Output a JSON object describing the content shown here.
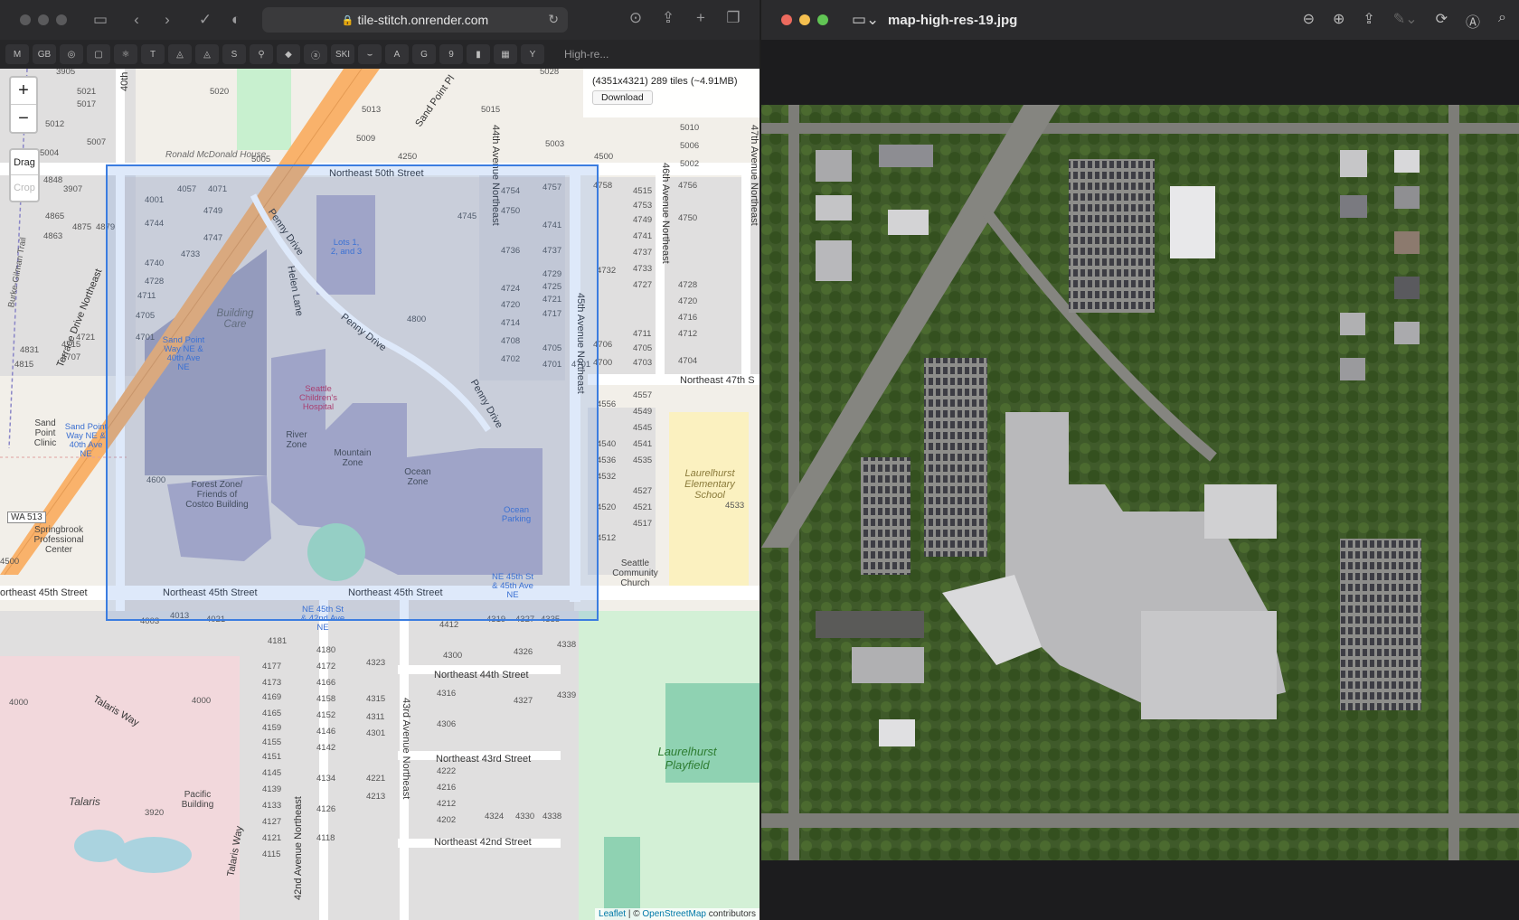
{
  "safari": {
    "url": "tile-stitch.onrender.com",
    "favorites": [
      "M",
      "GB",
      "◎",
      "▢",
      "⚛",
      "T",
      "◬",
      "◬",
      "S",
      "⚲",
      "◆",
      "ⓐ",
      "SKI",
      "⌣",
      "A",
      "G",
      "9",
      "▮",
      "▦",
      "Y"
    ],
    "tab_label": "High-re..."
  },
  "map": {
    "zoom_in": "+",
    "zoom_out": "−",
    "drag_label": "Drag",
    "crop_label": "Crop",
    "info_text": "(4351x4321) 289 tiles (~4.91MB)",
    "download_label": "Download",
    "attribution_leaflet": "Leaflet",
    "attribution_sep": " | © ",
    "attribution_osm": "OpenStreetMap",
    "attribution_tail": " contributors",
    "streets": {
      "ne50": "Northeast 50th Street",
      "ne47": "Northeast 47th S",
      "ne45_a": "Northeast 45th Street",
      "ne45_b": "Northeast 45th Street",
      "ne45_left": "ortheast 45th Street",
      "ne44": "Northeast 44th Street",
      "ne43": "Northeast 43rd Street",
      "ne42": "Northeast 42nd Street",
      "ave45": "45th Avenue Northeast",
      "ave46": "46th Avenue Northeast",
      "ave47": "47th Avenue Northeast",
      "ave44": "44th Avenue Northeast",
      "ave43": "43rd Avenue Northeast",
      "ave42": "42nd Avenue Northeast",
      "ave40": "40th",
      "penny1": "Penny Drive",
      "penny2": "Penny Drive",
      "penny3": "Penny Drive",
      "helen": "Helen Lane",
      "sandpoint": "Sand Point Pl",
      "terrace": "Terrace Drive Northeast",
      "burke": "Burke-Gilman Trail",
      "talaris_way": "Talaris Way",
      "talaris_way2": "Talaris Way",
      "wa513": "WA 513"
    },
    "places": {
      "ronald": "Ronald McDonald House",
      "building_care": "Building Care",
      "hospital": "Seattle Children's Hospital",
      "river": "River Zone",
      "mountain": "Mountain Zone",
      "ocean": "Ocean Zone",
      "forest": "Forest Zone/ Friends of Costco Building",
      "ocean_parking": "Ocean Parking",
      "lots": "Lots 1, 2, and 3",
      "sand_clinic": "Sand Point Clinic",
      "springbrook": "Springbrook Professional Center",
      "laurelhurst_school": "Laurelhurst Elementary School",
      "church": "Seattle Community Church",
      "playfield": "Laurelhurst Playfield",
      "talaris": "Talaris",
      "pacific": "Pacific Building",
      "stop1": "Sand Point Way NE & 40th Ave NE",
      "stop2": "Sand Point Way NE & 40th Ave NE",
      "stop3": "NE 45th St & 45th Ave NE",
      "stop4": "NE 45th St & 42nd Ave NE"
    },
    "house_numbers": {
      "n3905": "3905",
      "n5028": "5028",
      "n5020": "5020",
      "n5021": "5021",
      "n5017": "5017",
      "n5013": "5013",
      "n5012": "5012",
      "n5015": "5015",
      "n5007": "5007",
      "n5004": "5004",
      "n5009": "5009",
      "n5005": "5005",
      "n4250": "4250",
      "n4500": "4500",
      "n5003": "5003",
      "n5002": "5002",
      "n5006": "5006",
      "n5010": "5010",
      "n4848": "4848",
      "n3907": "3907",
      "n4001": "4001",
      "n4057": "4057",
      "n4071": "4071",
      "n4865": "4865",
      "n4875": "4875",
      "n4879": "4879",
      "n4749": "4749",
      "n4744": "4744",
      "n4747": "4747",
      "n4863": "4863",
      "n4733": "4733",
      "n4740": "4740",
      "n4728": "4728",
      "n4711": "4711",
      "n4705": "4705",
      "n4701": "4701",
      "n4721": "4721",
      "n4715": "4715",
      "n4707": "4707",
      "n4831": "4831",
      "n4815": "4815",
      "n4800": "4800",
      "n4745": "4745",
      "n4754": "4754",
      "n4757": "4757",
      "n4750": "4750",
      "n4741": "4741",
      "n4736": "4736",
      "n4737": "4737",
      "n4729": "4729",
      "n4724": "4724",
      "n4725": "4725",
      "n4720": "4720",
      "n4721b": "4721",
      "n4714": "4714",
      "n4717": "4717",
      "n4708": "4708",
      "n4705b": "4705",
      "n4702": "4702",
      "n4701b": "4701",
      "n4600": "4600",
      "n4013": "4013",
      "n4021": "4021",
      "n4003": "4003",
      "n4181": "4181",
      "n4000": "4000",
      "n4000b": "4000",
      "n3920": "3920",
      "n4319": "4319",
      "n4327": "4327",
      "n4335": "4335",
      "n4412": "4412",
      "n4300": "4300",
      "n4326": "4326",
      "n4338": "4338",
      "n4323": "4323",
      "n4316": "4316",
      "n4327b": "4327",
      "n4339": "4339",
      "n4306": "4306",
      "n4315": "4315",
      "n4311": "4311",
      "n4301": "4301",
      "n4222": "4222",
      "n4216": "4216",
      "n4212": "4212",
      "n4202": "4202",
      "n4221": "4221",
      "n4213": "4213",
      "n4324": "4324",
      "n4330": "4330",
      "n4338b": "4338",
      "n4180": "4180",
      "n4172": "4172",
      "n4166": "4166",
      "n4158": "4158",
      "n4152": "4152",
      "n4146": "4146",
      "n4142": "4142",
      "n4134": "4134",
      "n4126": "4126",
      "n4118": "4118",
      "n4177": "4177",
      "n4173": "4173",
      "n4169": "4169",
      "n4165": "4165",
      "n4159": "4159",
      "n4155": "4155",
      "n4151": "4151",
      "n4145": "4145",
      "n4139": "4139",
      "n4133": "4133",
      "n4127": "4127",
      "n4121": "4121",
      "n4115": "4115",
      "n4756": "4756",
      "n4750b": "4750",
      "n4758": "4758",
      "n4515": "4515",
      "n4753": "4753",
      "n4749b": "4749",
      "n4741b": "4741",
      "n4737b": "4737",
      "n4732": "4732",
      "n4733b": "4733",
      "n4727": "4727",
      "n4728b": "4728",
      "n4720b": "4720",
      "n4716": "4716",
      "n4712": "4712",
      "n4711b": "4711",
      "n4706": "4706",
      "n4705c": "4705",
      "n4703": "4703",
      "n4704": "4704",
      "n4700": "4700",
      "n4557": "4557",
      "n4556": "4556",
      "n4549": "4549",
      "n4540": "4540",
      "n4545": "4545",
      "n4541": "4541",
      "n4536": "4536",
      "n4535": "4535",
      "n4532": "4532",
      "n4527": "4527",
      "n4520": "4520",
      "n4521": "4521",
      "n4517": "4517",
      "n4512": "4512",
      "n4533": "4533",
      "n4701c": "4701"
    }
  },
  "preview": {
    "title": "map-high-res-19.jpg",
    "icons": [
      "sidebar-icon",
      "zoom-out-icon",
      "zoom-in-icon",
      "share-icon",
      "markup-icon",
      "rotate-icon",
      "accessibility-icon",
      "search-icon"
    ]
  },
  "colors": {
    "selection": "#3b7de0",
    "hospital_fill": "#d9d0c9",
    "building": "#b7adc2",
    "park": "#c8f0cf",
    "school": "#fdf3c0",
    "residential": "#e0dfdf",
    "highway": "#f9b26b"
  }
}
